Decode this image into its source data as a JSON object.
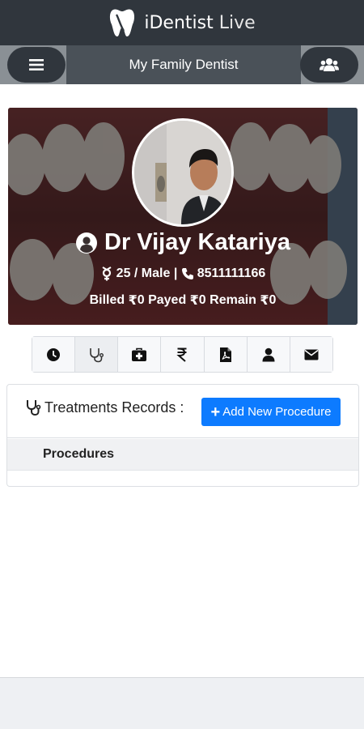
{
  "app": {
    "brand_primary": "iDentist",
    "brand_secondary": " Live"
  },
  "nav": {
    "title": "My Family Dentist",
    "menu_icon": "hamburger-icon",
    "group_icon": "users-icon"
  },
  "profile": {
    "name": "Dr Vijay Katariya",
    "age_gender": "25 / Male | ",
    "phone": "8511111166",
    "billed_label": "Billed ",
    "billed_value": "0",
    "payed_label": " Payed ",
    "payed_value": "0",
    "remain_label": " Remain ",
    "remain_value": "0",
    "currency_symbol": "₹"
  },
  "toolbar": {
    "icons": [
      "clock-icon",
      "stethoscope-icon",
      "medkit-icon",
      "rupee-icon",
      "pdf-file-icon",
      "user-icon",
      "envelope-icon"
    ]
  },
  "treatments": {
    "title": "Treatments Records :",
    "add_button": "Add New Procedure",
    "column_header": "Procedures"
  },
  "colors": {
    "topbar": "#30363d",
    "navbar": "#8a9095",
    "primary_button": "#0d7bff"
  }
}
